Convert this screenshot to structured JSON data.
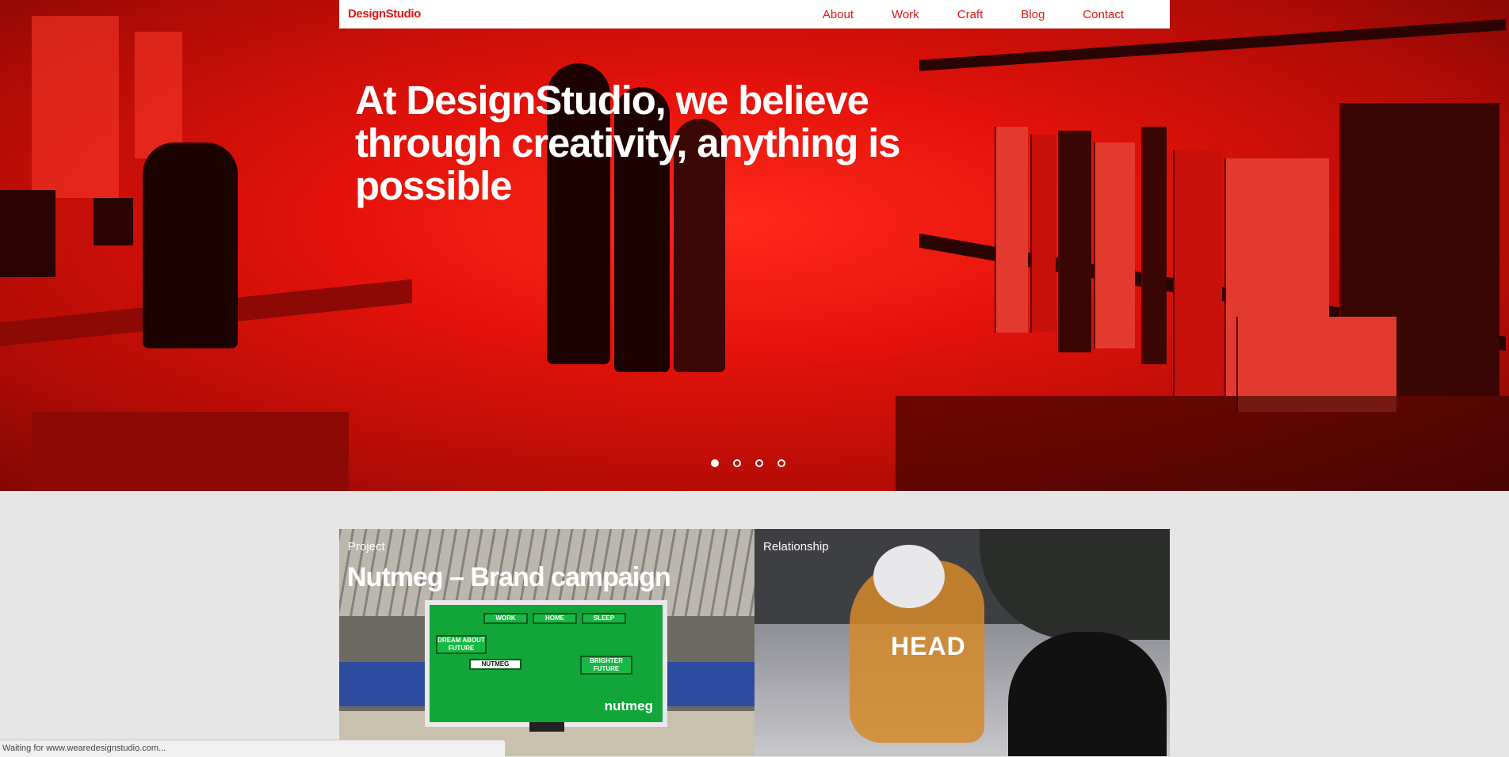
{
  "nav": {
    "logo": "DesignStudio",
    "links": [
      "About",
      "Work",
      "Craft",
      "Blog",
      "Contact"
    ]
  },
  "hero": {
    "headline": "At DesignStudio, we believe through creativity, anything is possible",
    "slides_total": 4,
    "active_slide": 1
  },
  "cards": [
    {
      "label": "Project",
      "title": "Nutmeg – Brand campaign"
    },
    {
      "label": "Relationship",
      "logo_text": "HEAD"
    }
  ],
  "billboard": {
    "boxes": [
      "WORK",
      "HOME",
      "SLEEP",
      "DREAM ABOUT FUTURE",
      "NUTMEG",
      "BRIGHTER FUTURE"
    ],
    "brand": "nutmeg"
  },
  "status": {
    "text": "Waiting for www.wearedesignstudio.com..."
  },
  "colors": {
    "accent": "#e01712",
    "hero_red": "#e4120a",
    "page_bg": "#e6e6e6"
  }
}
